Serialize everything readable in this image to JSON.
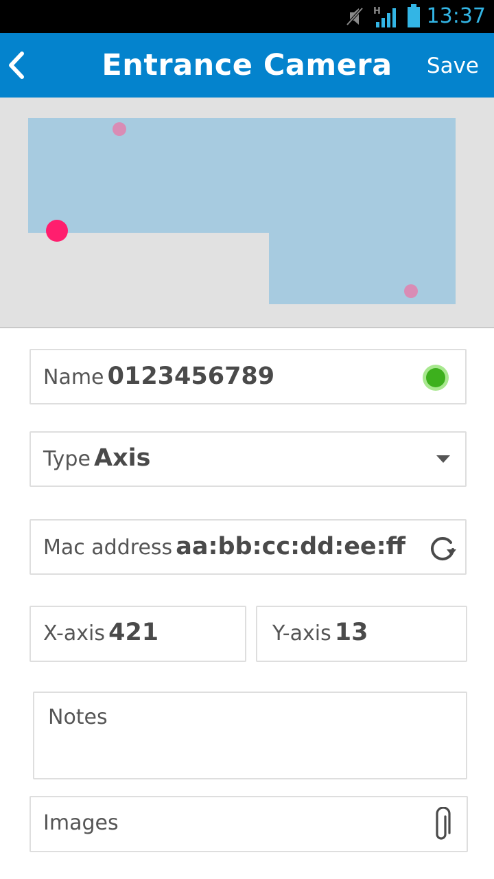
{
  "status_bar": {
    "time": "13:37"
  },
  "header": {
    "title": "Entrance Camera",
    "save_label": "Save"
  },
  "map": {
    "marker_colors": {
      "selected": "#ff1e6e",
      "other": "#d98cb5",
      "area": "#a7cbe0"
    }
  },
  "form": {
    "name": {
      "label": "Name",
      "value": "0123456789",
      "status_color": "#3db01d"
    },
    "type": {
      "label": "Type",
      "value": "Axis"
    },
    "mac": {
      "label": "Mac address",
      "value": "aa:bb:cc:dd:ee:ff"
    },
    "x_axis": {
      "label": "X-axis",
      "value": "421"
    },
    "y_axis": {
      "label": "Y-axis",
      "value": "13"
    },
    "notes": {
      "placeholder": "Notes"
    },
    "images": {
      "label": "Images"
    }
  },
  "colors": {
    "accent": "#0483cd",
    "status_time": "#33b5e5"
  }
}
